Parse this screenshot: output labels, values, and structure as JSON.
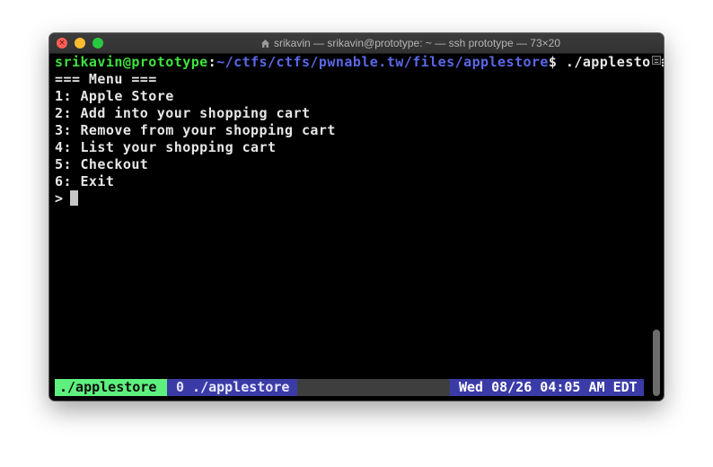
{
  "window": {
    "title": "srikavin — srikavin@prototype: ~ — ssh prototype — 73×20",
    "icon": "home-icon"
  },
  "terminal": {
    "prompt_user_host": "srikavin@prototype",
    "prompt_sep": ":",
    "prompt_path": "~/ctfs/ctfs/pwnable.tw/files/applestore",
    "prompt_dollar": "$",
    "command": " ./applestore",
    "menu_header": "=== Menu ===",
    "menu_items": [
      "1: Apple Store",
      "2: Add into your shopping cart",
      "3: Remove from your shopping cart",
      "4: List your shopping cart",
      "5: Checkout",
      "6: Exit"
    ],
    "input_prompt": ">"
  },
  "statusbar": {
    "active_window": "./applestore",
    "window_list": "0 ./applestore",
    "clock": "Wed 08/26 04:05 AM EDT"
  },
  "colors": {
    "prompt_user": "#3fe23f",
    "prompt_path": "#5b68e8",
    "status_active_bg": "#5ef07e",
    "status_bg": "#3b3ba8"
  }
}
